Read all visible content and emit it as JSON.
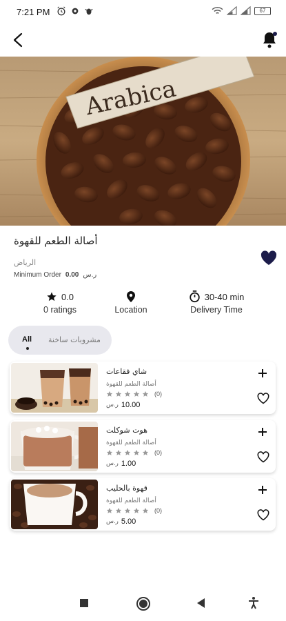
{
  "status": {
    "time": "7:21 PM",
    "battery": "67",
    "icons_left": [
      "alarm-icon",
      "settings-icon",
      "bug-icon"
    ],
    "icons_right": [
      "wifi-icon",
      "signal-icon",
      "signal-icon",
      "battery-icon"
    ]
  },
  "topbar": {
    "back_icon": "chevron-left-icon",
    "bell_icon": "bell-icon"
  },
  "hero": {
    "label_text": "Arabica",
    "image": "coffee-beans-bowl"
  },
  "store": {
    "name": "أصالة الطعم للقهوة",
    "city": "الرياض",
    "min_order_label": "Minimum Order",
    "min_order_value": "0.00",
    "currency": "ر.س"
  },
  "info": {
    "rating_value": "0.0",
    "ratings_label": "0 ratings",
    "location_label": "Location",
    "delivery_time": "30-40 min",
    "delivery_label": "Delivery Time"
  },
  "tabs": [
    {
      "label": "All",
      "active": true
    },
    {
      "label": "مشروبات ساخنة",
      "active": false
    }
  ],
  "products": [
    {
      "name": "شاي فقاعات",
      "store": "أصالة الطعم للقهوة",
      "rating": 0,
      "rating_count": "(0)",
      "price": "10.00",
      "currency": "ر.س",
      "image": "bubble-tea"
    },
    {
      "name": "هوت شوكلت",
      "store": "أصالة الطعم للقهوة",
      "rating": 0,
      "rating_count": "(0)",
      "price": "1.00",
      "currency": "ر.س",
      "image": "hot-chocolate"
    },
    {
      "name": "قهوة بالحليب",
      "store": "أصالة الطعم للقهوة",
      "rating": 0,
      "rating_count": "(0)",
      "price": "5.00",
      "currency": "ر.س",
      "image": "coffee-with-milk"
    }
  ],
  "colors": {
    "accent": "#1c1c4a",
    "star_inactive": "#9a9a9a",
    "tab_bg": "#e8e8ee"
  },
  "navbar": {
    "icons": [
      "square-recents-icon",
      "circle-home-icon",
      "triangle-back-icon",
      "accessibility-icon"
    ]
  }
}
